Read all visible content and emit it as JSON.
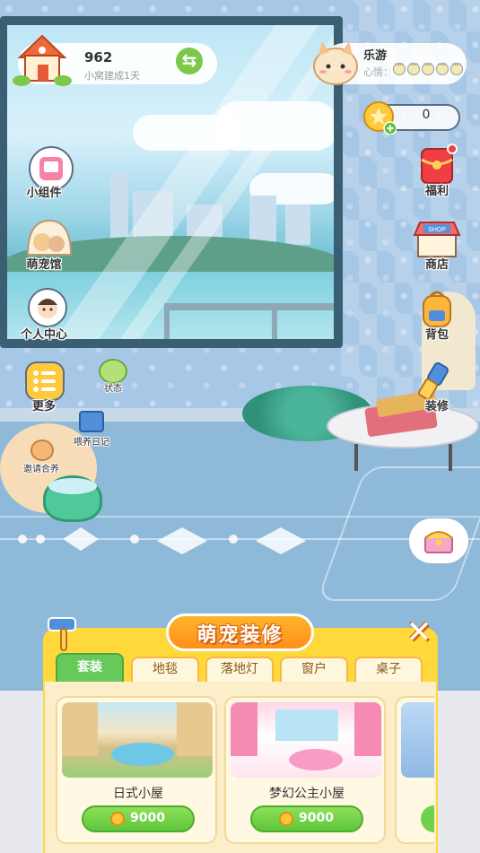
{
  "home": {
    "count": "962",
    "subtitle": "小窝建成1天"
  },
  "profile": {
    "name": "乐游",
    "mood_label": "心情："
  },
  "coins": {
    "value": "0"
  },
  "left_menu": [
    {
      "label": "小组件",
      "icon": "widget-icon"
    },
    {
      "label": "萌宠馆",
      "icon": "pet-hall-icon"
    },
    {
      "label": "个人中心",
      "icon": "profile-center-icon"
    },
    {
      "label": "更多",
      "icon": "more-icon"
    }
  ],
  "right_menu": [
    {
      "label": "福利",
      "icon": "gift-envelope-icon"
    },
    {
      "label": "商店",
      "icon": "shop-icon"
    },
    {
      "label": "背包",
      "icon": "backpack-icon"
    },
    {
      "label": "装修",
      "icon": "paint-brush-icon"
    }
  ],
  "room_badges": {
    "status": "状态",
    "feed_diary": "喂养日记",
    "invite_pet": "邀请合养"
  },
  "decor_panel": {
    "title": "萌宠装修",
    "tabs": [
      "套装",
      "地毯",
      "落地灯",
      "窗户",
      "桌子"
    ],
    "active_tab": "套装",
    "items": [
      {
        "name": "日式小屋",
        "price": "9000"
      },
      {
        "name": "梦幻公主小屋",
        "price": "9000"
      }
    ]
  },
  "colors": {
    "accent_green": "#66c95a",
    "panel_yellow": "#ffd83c",
    "title_orange": "#ff8e1c"
  }
}
